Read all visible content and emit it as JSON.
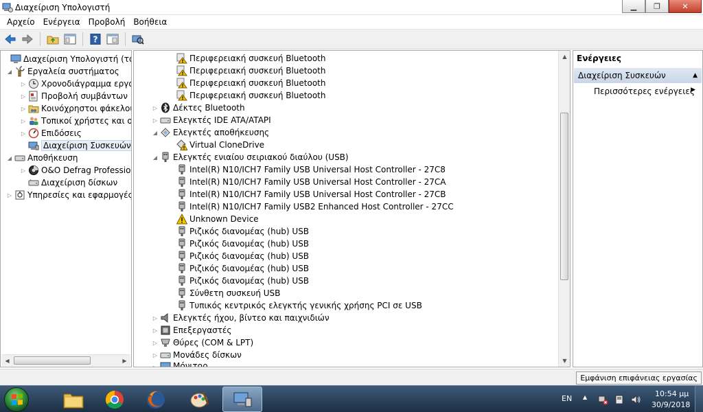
{
  "window": {
    "title": "Διαχείριση Υπολογιστή"
  },
  "menu": [
    "Αρχείο",
    "Ενέργεια",
    "Προβολή",
    "Βοήθεια"
  ],
  "toolbar": {
    "buttons": [
      "back-arrow-icon",
      "forward-arrow-icon",
      "up-folder-icon",
      "show-hide-tree-icon",
      "help-icon",
      "properties-icon",
      "scan-hardware-icon"
    ]
  },
  "left_tree": {
    "root": "Διαχείριση Υπολογιστή (τοπικ",
    "system_tools": "Εργαλεία συστήματος",
    "task_scheduler": "Χρονοδιάγραμμα εργασ",
    "event_viewer": "Προβολή συμβάντων",
    "shared_folders": "Κοινόχρηστοι φάκελοι",
    "local_users": "Τοπικοί χρήστες και ομ",
    "performance": "Επιδόσεις",
    "device_manager": "Διαχείριση Συσκευών",
    "storage": "Αποθήκευση",
    "defrag": "O&O Defrag Profession",
    "disk_management": "Διαχείριση δίσκων",
    "services_apps": "Υπηρεσίες και εφαρμογές"
  },
  "device_tree": {
    "bt_device_1": "Περιφερειακή συσκευή Bluetooth",
    "bt_device_2": "Περιφερειακή συσκευή Bluetooth",
    "bt_device_3": "Περιφερειακή συσκευή Bluetooth",
    "bt_device_4": "Περιφερειακή συσκευή Bluetooth",
    "bt_receivers": "Δέκτες Bluetooth",
    "ide_controllers": "Ελεγκτές IDE ATA/ATAPI",
    "storage_controllers": "Ελεγκτές αποθήκευσης",
    "virtual_clonedrive": "Virtual CloneDrive",
    "usb_controllers": "Ελεγκτές ενιαίου σειριακού διαύλου (USB)",
    "usb_27c8": "Intel(R) N10/ICH7 Family USB Universal Host Controller - 27C8",
    "usb_27ca": "Intel(R) N10/ICH7 Family USB Universal Host Controller - 27CA",
    "usb_27cb": "Intel(R) N10/ICH7 Family USB Universal Host Controller - 27CB",
    "usb_27cc": "Intel(R) N10/ICH7 Family USB2 Enhanced Host Controller - 27CC",
    "unknown_device": "Unknown Device",
    "root_hub_1": "Ριζικός διανομέας (hub) USB",
    "root_hub_2": "Ριζικός διανομέας (hub) USB",
    "root_hub_3": "Ριζικός διανομέας (hub) USB",
    "root_hub_4": "Ριζικός διανομέας (hub) USB",
    "root_hub_5": "Ριζικός διανομέας (hub) USB",
    "composite_usb": "Σύνθετη συσκευή USB",
    "pci_to_usb": "Τυπικός κεντρικός ελεγκτής γενικής χρήσης PCI σε USB",
    "sound": "Ελεγκτές ήχου, βίντεο και παιχνιδιών",
    "processors": "Επεξεργαστές",
    "ports": "Θύρες (COM & LPT)",
    "disk_drives": "Μονάδες δίσκων",
    "monitors": "Μόνιτορ"
  },
  "actions": {
    "header": "Ενέργειες",
    "section": "Διαχείριση Συσκευών",
    "more": "Περισσότερες ενέργειες"
  },
  "statusbar": {
    "button": "Εμφάνιση επιφάνειας εργασίας"
  },
  "taskbar": {
    "apps": [
      "file-explorer-icon",
      "chrome-icon",
      "firefox-icon",
      "paint-icon",
      "computer-management-icon"
    ],
    "lang": "EN",
    "time": "10:54 μμ",
    "date": "30/9/2018"
  },
  "colors": {
    "selection": "#e8eef6",
    "actions_band": "#c9d6e8",
    "taskbar": "#2a4058",
    "close_button": "#c2402a",
    "warning": "#f2c400"
  }
}
